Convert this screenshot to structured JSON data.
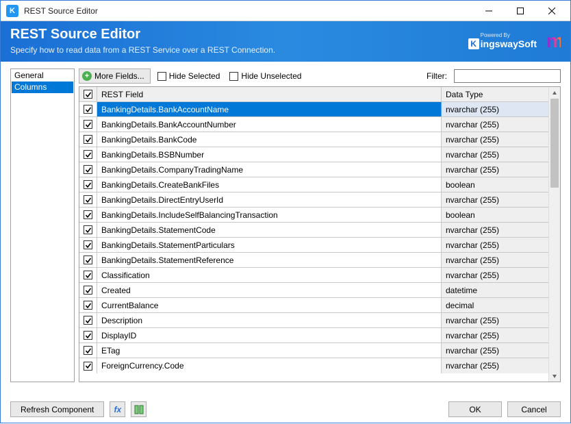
{
  "window": {
    "title": "REST Source Editor"
  },
  "header": {
    "title": "REST Source Editor",
    "subtitle": "Specify how to read data from a REST Service over a REST Connection.",
    "powered_by": "Powered By",
    "brand": "ingswaySoft"
  },
  "sidebar": {
    "items": [
      {
        "label": "General",
        "selected": false
      },
      {
        "label": "Columns",
        "selected": true
      }
    ]
  },
  "toolbar": {
    "more_fields": "More Fields...",
    "hide_selected": "Hide Selected",
    "hide_unselected": "Hide Unselected",
    "filter_label": "Filter:",
    "filter_value": ""
  },
  "grid": {
    "col_check_aria": "Select all",
    "col_field": "REST Field",
    "col_type": "Data Type",
    "rows": [
      {
        "field": "BankingDetails.BankAccountName",
        "type": "nvarchar (255)",
        "checked": true,
        "selected": true
      },
      {
        "field": "BankingDetails.BankAccountNumber",
        "type": "nvarchar (255)",
        "checked": true
      },
      {
        "field": "BankingDetails.BankCode",
        "type": "nvarchar (255)",
        "checked": true
      },
      {
        "field": "BankingDetails.BSBNumber",
        "type": "nvarchar (255)",
        "checked": true
      },
      {
        "field": "BankingDetails.CompanyTradingName",
        "type": "nvarchar (255)",
        "checked": true
      },
      {
        "field": "BankingDetails.CreateBankFiles",
        "type": "boolean",
        "checked": true
      },
      {
        "field": "BankingDetails.DirectEntryUserId",
        "type": "nvarchar (255)",
        "checked": true
      },
      {
        "field": "BankingDetails.IncludeSelfBalancingTransaction",
        "type": "boolean",
        "checked": true
      },
      {
        "field": "BankingDetails.StatementCode",
        "type": "nvarchar (255)",
        "checked": true
      },
      {
        "field": "BankingDetails.StatementParticulars",
        "type": "nvarchar (255)",
        "checked": true
      },
      {
        "field": "BankingDetails.StatementReference",
        "type": "nvarchar (255)",
        "checked": true
      },
      {
        "field": "Classification",
        "type": "nvarchar (255)",
        "checked": true
      },
      {
        "field": "Created",
        "type": "datetime",
        "checked": true
      },
      {
        "field": "CurrentBalance",
        "type": "decimal",
        "checked": true
      },
      {
        "field": "Description",
        "type": "nvarchar (255)",
        "checked": true
      },
      {
        "field": "DisplayID",
        "type": "nvarchar (255)",
        "checked": true
      },
      {
        "field": "ETag",
        "type": "nvarchar (255)",
        "checked": true
      },
      {
        "field": "ForeignCurrency.Code",
        "type": "nvarchar (255)",
        "checked": true
      }
    ]
  },
  "footer": {
    "refresh": "Refresh Component",
    "ok": "OK",
    "cancel": "Cancel"
  }
}
